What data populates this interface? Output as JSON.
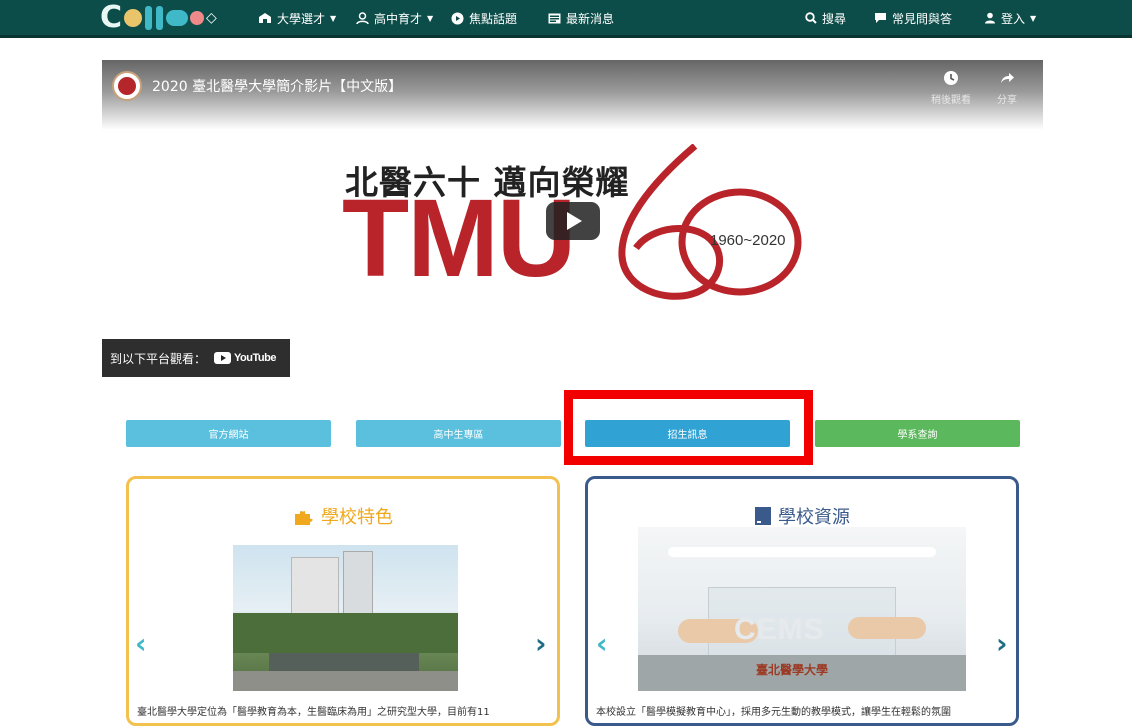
{
  "nav": {
    "logo_text": "C",
    "items": [
      {
        "label": "大學選才",
        "has_caret": true
      },
      {
        "label": "高中育才",
        "has_caret": true
      },
      {
        "label": "焦點話題",
        "has_caret": false
      },
      {
        "label": "最新消息",
        "has_caret": false
      }
    ],
    "right_items": [
      {
        "label": "搜尋"
      },
      {
        "label": "常見問與答"
      },
      {
        "label": "登入",
        "has_caret": true
      }
    ],
    "colors": {
      "bar": "#0d4d49"
    }
  },
  "video": {
    "title": "2020 臺北醫學大學簡介影片【中文版】",
    "watch_later": "稍後觀看",
    "share": "分享",
    "headline": "北醫六十 邁向榮耀",
    "brand": "TMU",
    "years": "1960~2020",
    "watch_on_label": "到以下平台觀看：",
    "youtube_label": "YouTube"
  },
  "actions": [
    {
      "label": "官方網站",
      "color": "#5bc0de"
    },
    {
      "label": "高中生專區",
      "color": "#5bc0de"
    },
    {
      "label": "招生訊息",
      "color": "#31a2d4"
    },
    {
      "label": "學系查詢",
      "color": "#5cb85c"
    }
  ],
  "cards": {
    "features": {
      "title": "學校特色",
      "text": "臺北醫學大學定位為「醫學教育為本，生醫臨床為用」之研究型大學，目前有11",
      "border_color": "#f2c14e",
      "title_color": "#f0a81c"
    },
    "resources": {
      "title": "學校資源",
      "text": "本校設立「醫學模擬教育中心」，採用多元生動的教學模式，讓學生在輕鬆的氛圍",
      "border_color": "#3a5a8c",
      "title_color": "#3a5a8c",
      "photo_caption": "臺北醫學大學",
      "photo_sign": "CEMS"
    }
  }
}
